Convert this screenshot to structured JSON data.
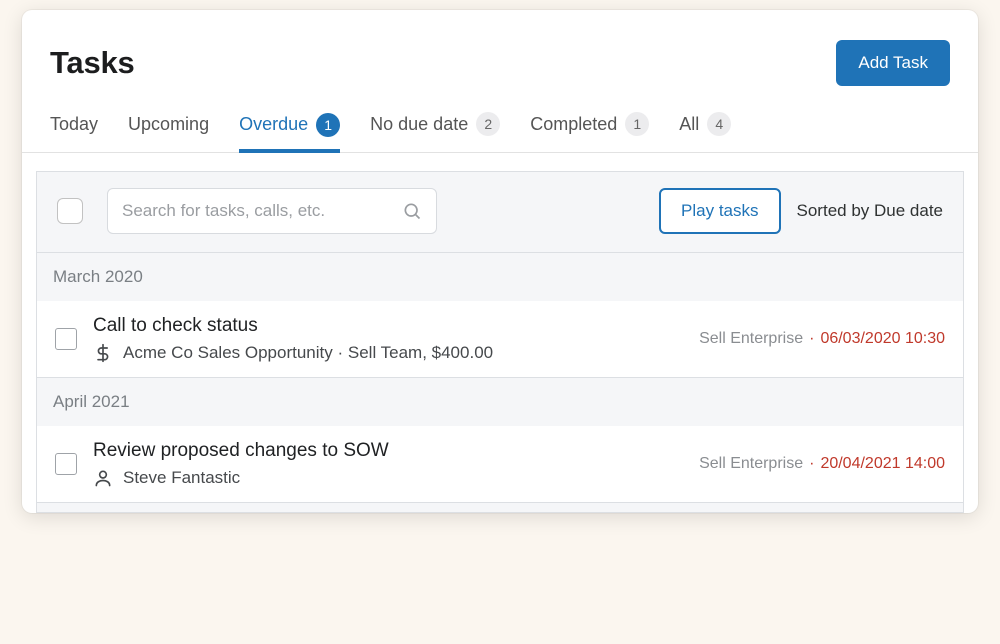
{
  "header": {
    "title": "Tasks",
    "add_button": "Add Task"
  },
  "tabs": [
    {
      "label": "Today",
      "count": null,
      "active": false
    },
    {
      "label": "Upcoming",
      "count": null,
      "active": false
    },
    {
      "label": "Overdue",
      "count": "1",
      "active": true
    },
    {
      "label": "No due date",
      "count": "2",
      "active": false
    },
    {
      "label": "Completed",
      "count": "1",
      "active": false
    },
    {
      "label": "All",
      "count": "4",
      "active": false
    }
  ],
  "toolbar": {
    "search_placeholder": "Search for tasks, calls, etc.",
    "play_label": "Play tasks",
    "sort_label": "Sorted by Due date"
  },
  "groups": [
    {
      "label": "March 2020",
      "tasks": [
        {
          "title": "Call to check status",
          "icon": "dollar",
          "subtitle": "Acme Co Sales Opportunity · Sell Team, $400.00",
          "tag": "Sell Enterprise",
          "due": "06/03/2020 10:30"
        }
      ]
    },
    {
      "label": "April 2021",
      "tasks": [
        {
          "title": "Review proposed changes to SOW",
          "icon": "person",
          "subtitle": "Steve Fantastic",
          "tag": "Sell Enterprise",
          "due": "20/04/2021 14:00"
        }
      ]
    }
  ]
}
